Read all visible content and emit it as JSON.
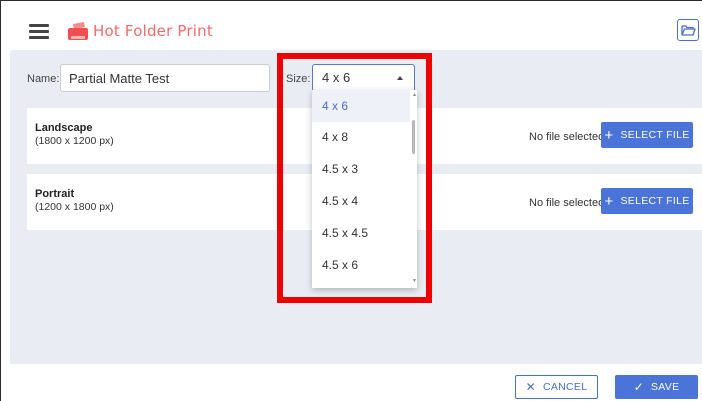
{
  "header": {
    "title": "Hot Folder Print",
    "menu_icon": "hamburger-menu-icon",
    "logo_icon": "printer-logo-icon",
    "folder_icon": "folder-open-icon"
  },
  "form": {
    "name_label": "Name:",
    "name_value": "Partial Matte Test",
    "size_label": "Size:",
    "size_value": "4 x 6",
    "size_options": [
      "4 x 6",
      "4 x 8",
      "4.5 x 3",
      "4.5 x 4",
      "4.5 x 4.5",
      "4.5 x 6"
    ]
  },
  "cards": [
    {
      "title": "Landscape",
      "dimensions": "(1800 x 1200 px)",
      "status": "No file selected",
      "button": "SELECT FILE"
    },
    {
      "title": "Portrait",
      "dimensions": "(1200 x 1800 px)",
      "status": "No file selected",
      "button": "SELECT FILE"
    }
  ],
  "footer": {
    "cancel": "CANCEL",
    "save": "SAVE"
  },
  "colors": {
    "accent": "#4a74d8",
    "brand": "#f26a6a",
    "highlight": "#ee0000",
    "background": "#e9ecf3"
  }
}
